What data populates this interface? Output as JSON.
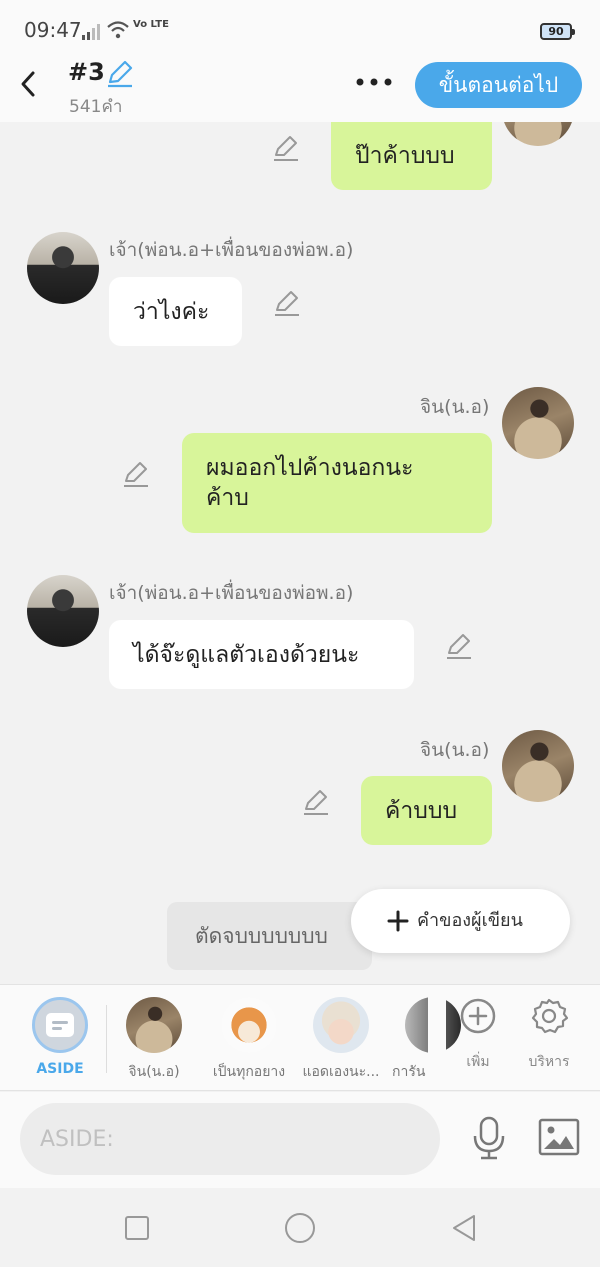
{
  "status_bar": {
    "time": "09:47",
    "network": "Vo LTE",
    "battery": "90"
  },
  "header": {
    "episode": "#3",
    "word_count": "541คำ",
    "next_button": "ขั้นตอนต่อไป"
  },
  "chat": {
    "messages": [
      {
        "side": "right",
        "text": "ป๊าค้าบบบ",
        "avatar": "jin"
      },
      {
        "side": "left",
        "name": "เจ้า(พ่อน.อ+เพื่อนของพ่อพ.อ)",
        "text": "ว่าไงค่ะ",
        "avatar": "jao"
      },
      {
        "side": "right",
        "name": "จิน(น.อ)",
        "text": "ผมออกไปค้างนอกนะค้าบ",
        "line1": "ผมออกไปค้างนอกนะ",
        "line2": "ค้าบ",
        "avatar": "jin"
      },
      {
        "side": "left",
        "name": "เจ้า(พ่อน.อ+เพื่อนของพ่อพ.อ)",
        "text": "ได้จ๊ะดูแลตัวเองด้วยนะ",
        "avatar": "jao"
      },
      {
        "side": "right",
        "name": "จิน(น.อ)",
        "text": "ค้าบบบ",
        "avatar": "jin"
      }
    ],
    "end_chip": "ตัดจบบบบบบบ",
    "writer_note_button": "คำของผู้เขียน"
  },
  "character_bar": {
    "aside_label": "ASIDE",
    "characters": [
      {
        "label": "จิน(น.อ)"
      },
      {
        "label": "เป็นทุกอยาง"
      },
      {
        "label": "แอดเองนะ..."
      },
      {
        "label": "การัน"
      }
    ],
    "add_label": "เพิ่ม",
    "manage_label": "บริหาร"
  },
  "input": {
    "placeholder": "ASIDE:"
  },
  "colors": {
    "accent": "#4aa8ea",
    "own_bubble": "#d8f59a",
    "other_bubble": "#ffffff",
    "background": "#f2f2f2"
  },
  "icons": [
    "back-arrow-icon",
    "edit-pencil-icon",
    "more-icon",
    "plus-icon",
    "add-circle-icon",
    "gear-icon",
    "microphone-icon",
    "image-icon",
    "nav-recents-icon",
    "nav-home-icon",
    "nav-back-icon"
  ]
}
